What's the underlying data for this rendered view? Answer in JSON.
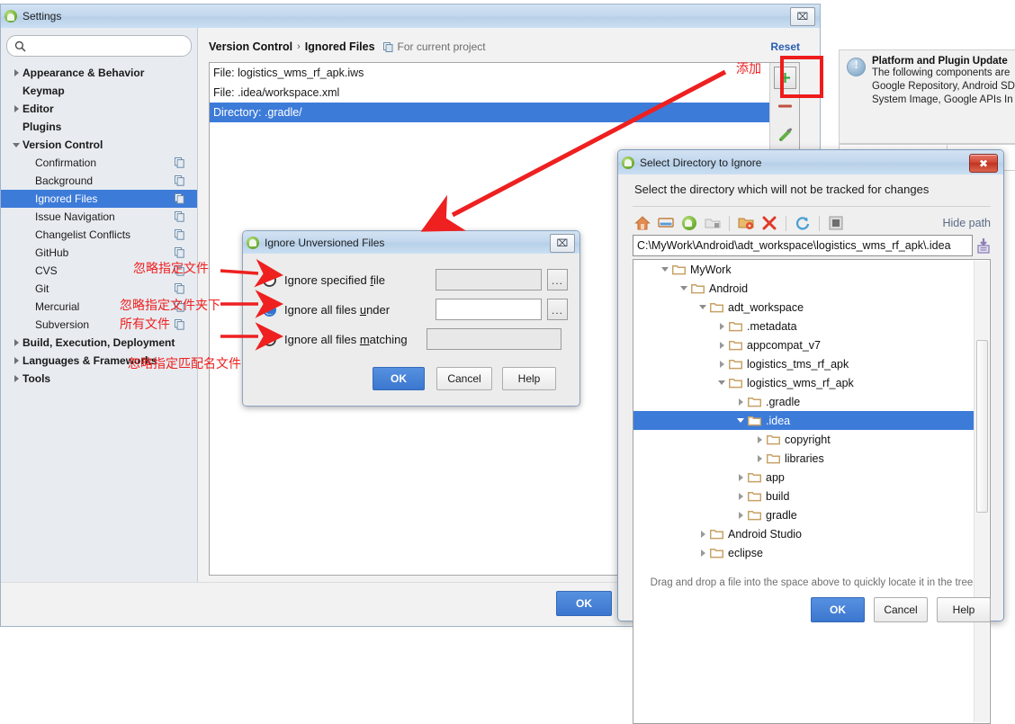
{
  "settings_window": {
    "title": "Settings",
    "icon": "android-studio-icon",
    "close_label": "⌧",
    "search": {
      "placeholder": "",
      "value": "",
      "icon": "search-icon"
    },
    "sidebar": [
      {
        "label": "Appearance & Behavior",
        "twisty": "right",
        "bold": true,
        "indent": 0,
        "copy": false,
        "selected": false
      },
      {
        "label": "Keymap",
        "twisty": "none",
        "bold": true,
        "indent": 0,
        "copy": false,
        "selected": false
      },
      {
        "label": "Editor",
        "twisty": "right",
        "bold": true,
        "indent": 0,
        "copy": false,
        "selected": false
      },
      {
        "label": "Plugins",
        "twisty": "none",
        "bold": true,
        "indent": 0,
        "copy": false,
        "selected": false
      },
      {
        "label": "Version Control",
        "twisty": "down",
        "bold": true,
        "indent": 0,
        "copy": false,
        "selected": false
      },
      {
        "label": "Confirmation",
        "twisty": "none",
        "bold": false,
        "indent": 1,
        "copy": true,
        "selected": false
      },
      {
        "label": "Background",
        "twisty": "none",
        "bold": false,
        "indent": 1,
        "copy": true,
        "selected": false
      },
      {
        "label": "Ignored Files",
        "twisty": "none",
        "bold": false,
        "indent": 1,
        "copy": true,
        "selected": true
      },
      {
        "label": "Issue Navigation",
        "twisty": "none",
        "bold": false,
        "indent": 1,
        "copy": true,
        "selected": false
      },
      {
        "label": "Changelist Conflicts",
        "twisty": "none",
        "bold": false,
        "indent": 1,
        "copy": true,
        "selected": false
      },
      {
        "label": "GitHub",
        "twisty": "none",
        "bold": false,
        "indent": 1,
        "copy": true,
        "selected": false
      },
      {
        "label": "CVS",
        "twisty": "none",
        "bold": false,
        "indent": 1,
        "copy": true,
        "selected": false
      },
      {
        "label": "Git",
        "twisty": "none",
        "bold": false,
        "indent": 1,
        "copy": true,
        "selected": false
      },
      {
        "label": "Mercurial",
        "twisty": "none",
        "bold": false,
        "indent": 1,
        "copy": true,
        "selected": false
      },
      {
        "label": "Subversion",
        "twisty": "none",
        "bold": false,
        "indent": 1,
        "copy": true,
        "selected": false
      },
      {
        "label": "Build, Execution, Deployment",
        "twisty": "right",
        "bold": true,
        "indent": 0,
        "copy": false,
        "selected": false
      },
      {
        "label": "Languages & Frameworks",
        "twisty": "right",
        "bold": true,
        "indent": 0,
        "copy": false,
        "selected": false
      },
      {
        "label": "Tools",
        "twisty": "right",
        "bold": true,
        "indent": 0,
        "copy": false,
        "selected": false
      }
    ],
    "breadcrumb": {
      "root": "Version Control",
      "separator": "›",
      "current": "Ignored Files",
      "scope_icon": "copy-icon",
      "scope_note": "For current project"
    },
    "reset_label": "Reset",
    "ignored_files": [
      {
        "label": "File: logistics_wms_rf_apk.iws",
        "selected": false
      },
      {
        "label": "File: .idea/workspace.xml",
        "selected": false
      },
      {
        "label": "Directory: .gradle/",
        "selected": true
      }
    ],
    "list_toolbar": [
      {
        "name": "add-button",
        "glyph": "+"
      },
      {
        "name": "remove-button",
        "glyph": "—"
      },
      {
        "name": "edit-button",
        "glyph": "pencil-icon"
      }
    ],
    "ok_label": "OK"
  },
  "notification": {
    "icon": "info-icon",
    "title": "Platform and Plugin Update",
    "lines": [
      "The following components are",
      "Google Repository, Android SD",
      "System Image, Google APIs In"
    ]
  },
  "ignore_dialog": {
    "title": "Ignore Unversioned Files",
    "icon": "android-studio-icon",
    "close_label": "⌧",
    "options": [
      {
        "label": "Ignore specified file",
        "underline": "f",
        "selected": false,
        "field_value": "",
        "field_enabled": false,
        "browse": "..."
      },
      {
        "label": "Ignore all files under",
        "underline": "u",
        "selected": true,
        "field_value": "",
        "field_enabled": true,
        "browse": "..."
      },
      {
        "label": "Ignore all files matching",
        "underline": "m",
        "selected": false,
        "field_value": "",
        "field_enabled": false,
        "browse": ""
      }
    ],
    "buttons": {
      "ok": "OK",
      "cancel": "Cancel",
      "help": "Help"
    }
  },
  "directory_dialog": {
    "title": "Select Directory to Ignore",
    "icon": "android-studio-icon",
    "close_label": "✖",
    "subtitle": "Select the directory which will not be tracked for changes",
    "toolbar": [
      {
        "name": "home-icon"
      },
      {
        "name": "desktop-icon"
      },
      {
        "name": "project-icon"
      },
      {
        "name": "folder-locked-icon"
      },
      {
        "name": "new-folder-icon"
      },
      {
        "name": "delete-icon"
      },
      {
        "name": "refresh-icon"
      },
      {
        "name": "show-hidden-icon"
      }
    ],
    "hide_path_label": "Hide path",
    "path_value": "C:\\MyWork\\Android\\adt_workspace\\logistics_wms_rf_apk\\.idea",
    "path_save_icon": "save-icon",
    "tree": [
      {
        "label": "MyWork",
        "indent": 1,
        "twisty": "down",
        "selected": false
      },
      {
        "label": "Android",
        "indent": 2,
        "twisty": "down",
        "selected": false
      },
      {
        "label": "adt_workspace",
        "indent": 3,
        "twisty": "down",
        "selected": false
      },
      {
        "label": ".metadata",
        "indent": 4,
        "twisty": "right",
        "selected": false
      },
      {
        "label": "appcompat_v7",
        "indent": 4,
        "twisty": "right",
        "selected": false
      },
      {
        "label": "logistics_tms_rf_apk",
        "indent": 4,
        "twisty": "right",
        "selected": false
      },
      {
        "label": "logistics_wms_rf_apk",
        "indent": 4,
        "twisty": "down",
        "selected": false
      },
      {
        "label": ".gradle",
        "indent": 5,
        "twisty": "right",
        "selected": false
      },
      {
        "label": ".idea",
        "indent": 5,
        "twisty": "down",
        "selected": true
      },
      {
        "label": "copyright",
        "indent": 6,
        "twisty": "right",
        "selected": false
      },
      {
        "label": "libraries",
        "indent": 6,
        "twisty": "right",
        "selected": false
      },
      {
        "label": "app",
        "indent": 5,
        "twisty": "right",
        "selected": false
      },
      {
        "label": "build",
        "indent": 5,
        "twisty": "right",
        "selected": false
      },
      {
        "label": "gradle",
        "indent": 5,
        "twisty": "right",
        "selected": false
      },
      {
        "label": "Android Studio",
        "indent": 3,
        "twisty": "right",
        "selected": false
      },
      {
        "label": "eclipse",
        "indent": 3,
        "twisty": "right",
        "selected": false
      }
    ],
    "drag_hint": "Drag and drop a file into the space above to quickly locate it in the tree",
    "buttons": {
      "ok": "OK",
      "cancel": "Cancel",
      "help": "Help"
    }
  },
  "annotations": {
    "add": "添加",
    "ignore_specified_file": "忽略指定文件",
    "ignore_all_under_line1": "忽略指定文件夹下",
    "ignore_all_under_line2": "所有文件",
    "ignore_matching": "忽略指定匹配名文件"
  },
  "colors": {
    "selection_blue": "#3d7bd9",
    "annotation_red": "#ee2020",
    "link_blue": "#2a5db0",
    "folder_tan": "#c8a165",
    "primary_button": "#3b77cf"
  }
}
